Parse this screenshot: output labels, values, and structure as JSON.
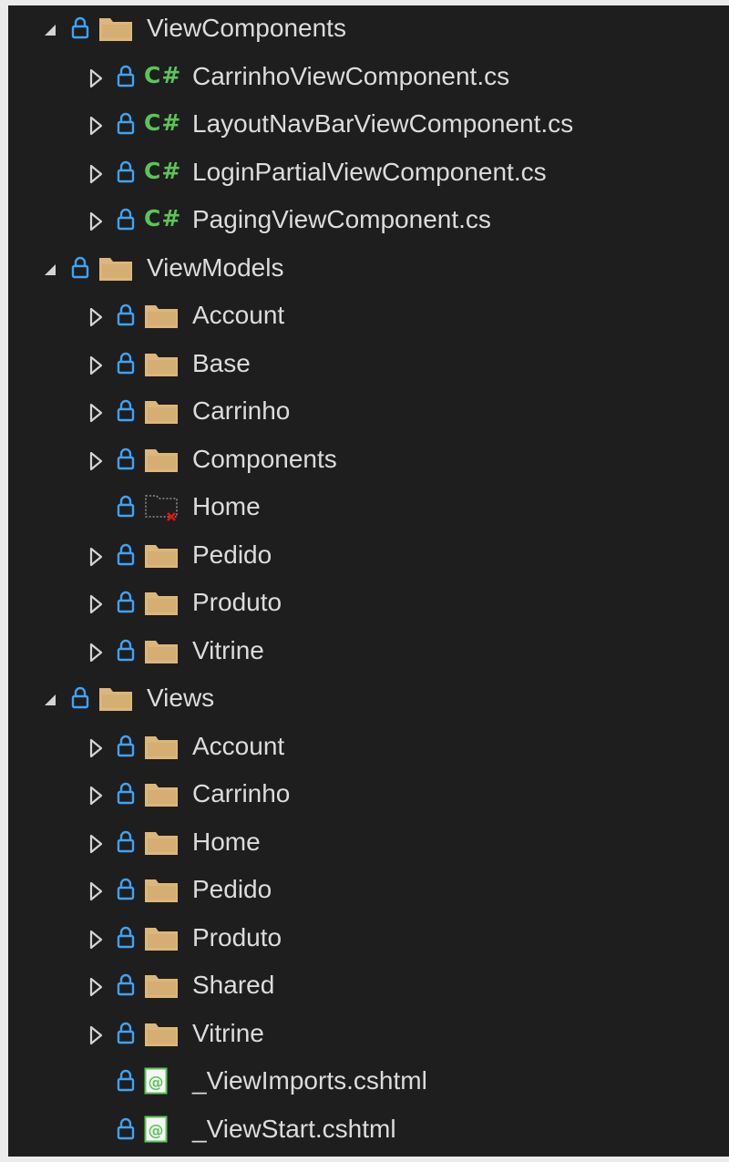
{
  "solution_explorer": {
    "colors": {
      "background": "#1e1e1e",
      "text": "#dcdcdc",
      "lock": "#3fa3f5",
      "folder": "#dcb67a",
      "csharp": "#5cc35a",
      "missing": "#e51400"
    },
    "icon_names": {
      "lock": "lock-icon",
      "folder": "folder-icon",
      "csharp": "csharp-file-icon",
      "razor": "razor-file-icon",
      "missing_folder": "missing-folder-icon",
      "expanded": "expanded-arrow-icon",
      "collapsed": "collapsed-arrow-icon"
    },
    "csharp_glyph": "C#",
    "items": [
      {
        "label": "ViewComponents",
        "type": "folder",
        "level": 0,
        "expander": "expanded"
      },
      {
        "label": "CarrinhoViewComponent.cs",
        "type": "csharp",
        "level": 1,
        "expander": "collapsed"
      },
      {
        "label": "LayoutNavBarViewComponent.cs",
        "type": "csharp",
        "level": 1,
        "expander": "collapsed"
      },
      {
        "label": "LoginPartialViewComponent.cs",
        "type": "csharp",
        "level": 1,
        "expander": "collapsed"
      },
      {
        "label": "PagingViewComponent.cs",
        "type": "csharp",
        "level": 1,
        "expander": "collapsed"
      },
      {
        "label": "ViewModels",
        "type": "folder",
        "level": 0,
        "expander": "expanded"
      },
      {
        "label": "Account",
        "type": "folder",
        "level": 1,
        "expander": "collapsed"
      },
      {
        "label": "Base",
        "type": "folder",
        "level": 1,
        "expander": "collapsed"
      },
      {
        "label": "Carrinho",
        "type": "folder",
        "level": 1,
        "expander": "collapsed"
      },
      {
        "label": "Components",
        "type": "folder",
        "level": 1,
        "expander": "collapsed"
      },
      {
        "label": "Home",
        "type": "missing-folder",
        "level": 1,
        "expander": "none"
      },
      {
        "label": "Pedido",
        "type": "folder",
        "level": 1,
        "expander": "collapsed"
      },
      {
        "label": "Produto",
        "type": "folder",
        "level": 1,
        "expander": "collapsed"
      },
      {
        "label": "Vitrine",
        "type": "folder",
        "level": 1,
        "expander": "collapsed"
      },
      {
        "label": "Views",
        "type": "folder",
        "level": 0,
        "expander": "expanded"
      },
      {
        "label": "Account",
        "type": "folder",
        "level": 1,
        "expander": "collapsed"
      },
      {
        "label": "Carrinho",
        "type": "folder",
        "level": 1,
        "expander": "collapsed"
      },
      {
        "label": "Home",
        "type": "folder",
        "level": 1,
        "expander": "collapsed"
      },
      {
        "label": "Pedido",
        "type": "folder",
        "level": 1,
        "expander": "collapsed"
      },
      {
        "label": "Produto",
        "type": "folder",
        "level": 1,
        "expander": "collapsed"
      },
      {
        "label": "Shared",
        "type": "folder",
        "level": 1,
        "expander": "collapsed"
      },
      {
        "label": "Vitrine",
        "type": "folder",
        "level": 1,
        "expander": "collapsed"
      },
      {
        "label": "_ViewImports.cshtml",
        "type": "razor",
        "level": 1,
        "expander": "none"
      },
      {
        "label": "_ViewStart.cshtml",
        "type": "razor",
        "level": 1,
        "expander": "none"
      }
    ]
  }
}
